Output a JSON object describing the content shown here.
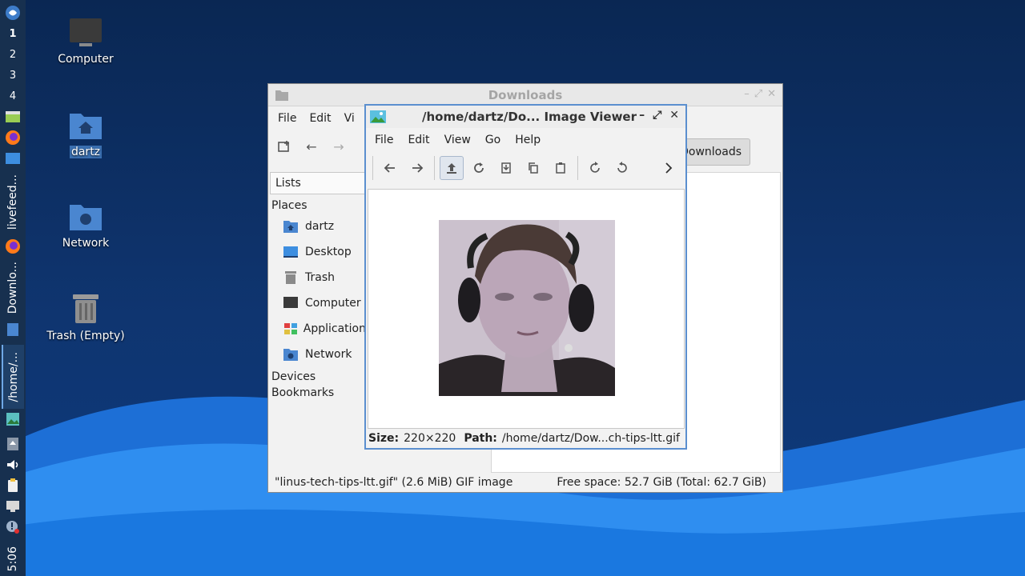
{
  "panel": {
    "workspaces": [
      "1",
      "2",
      "3",
      "4"
    ],
    "tasks": [
      "livefeed...",
      "Downlo...",
      "/home/..."
    ],
    "clock": "5:06"
  },
  "desktop": {
    "icons": [
      {
        "label": "Computer"
      },
      {
        "label": "dartz"
      },
      {
        "label": "Network"
      },
      {
        "label": "Trash (Empty)"
      }
    ]
  },
  "file_manager": {
    "title": "Downloads",
    "menu": [
      "File",
      "Edit",
      "Vi"
    ],
    "side_pane_type": "Lists",
    "sections": {
      "places": "Places",
      "devices": "Devices",
      "bookmarks": "Bookmarks"
    },
    "places": [
      "dartz",
      "Desktop",
      "Trash",
      "Computer",
      "Application",
      "Network"
    ],
    "path_button": "Downloads",
    "status_left": "\"linus-tech-tips-ltt.gif\" (2.6 MiB) GIF image",
    "status_right": "Free space: 52.7 GiB (Total: 62.7 GiB)"
  },
  "image_viewer": {
    "title": "/home/dartz/Do... Image Viewer",
    "menu": [
      "File",
      "Edit",
      "View",
      "Go",
      "Help"
    ],
    "status": {
      "size_label": "Size:",
      "size_value": "220×220",
      "path_label": "Path:",
      "path_value": "/home/dartz/Dow...ch-tips-ltt.gif"
    }
  },
  "colors": {
    "accent": "#5b8fcf",
    "panel": "#17304f",
    "folder_blue": "#4a86d0"
  }
}
